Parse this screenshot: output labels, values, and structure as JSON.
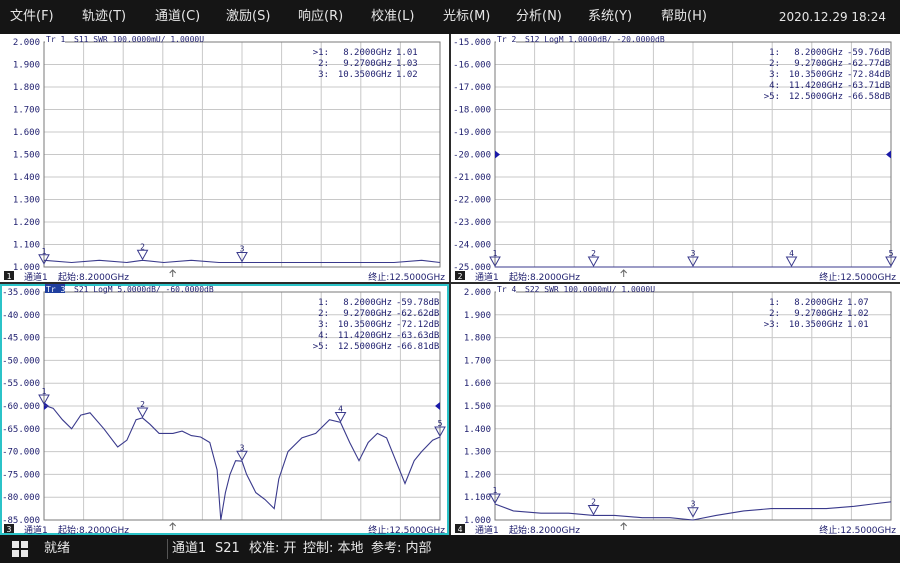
{
  "menu": [
    {
      "label": "文件(F)"
    },
    {
      "label": "轨迹(T)"
    },
    {
      "label": "通道(C)"
    },
    {
      "label": "激励(S)"
    },
    {
      "label": "响应(R)"
    },
    {
      "label": "校准(L)"
    },
    {
      "label": "光标(M)"
    },
    {
      "label": "分析(N)"
    },
    {
      "label": "系统(Y)"
    },
    {
      "label": "帮助(H)"
    }
  ],
  "datetime": "2020.12.29 18:24",
  "colors": {
    "grid": "#c8c8c8",
    "trace": "#3a3a8c",
    "text": "#1e1e6e",
    "active_border": "#2bc3c8",
    "footer_bg": "#ffffff"
  },
  "panels": [
    {
      "id": 1,
      "trace_label": "Tr 1",
      "trace_header": "S11 SWR 100.0000mU/ 1.0000U",
      "active": false,
      "y_ticks": [
        "2.000",
        "1.900",
        "1.800",
        "1.700",
        "1.600",
        "1.500",
        "1.400",
        "1.300",
        "1.200",
        "1.100",
        "1.000"
      ],
      "y_range": [
        1.0,
        2.0
      ],
      "ref_value": null,
      "trace": [
        [
          8.2,
          1.03
        ],
        [
          8.5,
          1.02
        ],
        [
          8.8,
          1.03
        ],
        [
          9.1,
          1.02
        ],
        [
          9.27,
          1.03
        ],
        [
          9.5,
          1.02
        ],
        [
          9.8,
          1.03
        ],
        [
          10.1,
          1.02
        ],
        [
          10.35,
          1.02
        ],
        [
          10.7,
          1.02
        ],
        [
          11.0,
          1.02
        ],
        [
          11.5,
          1.02
        ],
        [
          12.0,
          1.02
        ],
        [
          12.3,
          1.03
        ],
        [
          12.5,
          1.02
        ]
      ],
      "markers": [
        {
          "label": "1",
          "x": 8.2,
          "y": 1.01,
          "freq": "8.2000GHz",
          "value": "1.01",
          "selected": true
        },
        {
          "label": "2",
          "x": 9.27,
          "y": 1.03,
          "freq": "9.2700GHz",
          "value": "1.03",
          "selected": false
        },
        {
          "label": "3",
          "x": 10.35,
          "y": 1.02,
          "freq": "10.3500GHz",
          "value": "1.02",
          "selected": false
        }
      ],
      "footer": {
        "num": "1",
        "channel": "通道1",
        "start": "起始:8.2000GHz",
        "stop": "终止:12.5000GHz"
      }
    },
    {
      "id": 2,
      "trace_label": "Tr 2",
      "trace_header": "S12 LogM 1.0000dB/ -20.0000dB",
      "active": false,
      "y_ticks": [
        "-15.000",
        "-16.000",
        "-17.000",
        "-18.000",
        "-19.000",
        "-20.000",
        "-21.000",
        "-22.000",
        "-23.000",
        "-24.000",
        "-25.000"
      ],
      "y_range": [
        -25.0,
        -15.0
      ],
      "ref_value": -20.0,
      "trace": [
        [
          8.2,
          -25.0
        ],
        [
          12.5,
          -25.0
        ]
      ],
      "markers": [
        {
          "label": "1",
          "x": 8.2,
          "y": -25.0,
          "freq": "8.2000GHz",
          "value": "-59.76dB",
          "selected": false
        },
        {
          "label": "2",
          "x": 9.27,
          "y": -25.0,
          "freq": "9.2700GHz",
          "value": "-62.77dB",
          "selected": false
        },
        {
          "label": "3",
          "x": 10.35,
          "y": -25.0,
          "freq": "10.3500GHz",
          "value": "-72.84dB",
          "selected": false
        },
        {
          "label": "4",
          "x": 11.42,
          "y": -25.0,
          "freq": "11.4200GHz",
          "value": "-63.71dB",
          "selected": false
        },
        {
          "label": "5",
          "x": 12.5,
          "y": -25.0,
          "freq": "12.5000GHz",
          "value": "-66.58dB",
          "selected": true
        }
      ],
      "footer": {
        "num": "2",
        "channel": "通道1",
        "start": "起始:8.2000GHz",
        "stop": "终止:12.5000GHz"
      }
    },
    {
      "id": 3,
      "trace_label": "Tr 3",
      "trace_header": "S21 LogM 5.0000dB/ -60.0000dB",
      "active": true,
      "y_ticks": [
        "-35.000",
        "-40.000",
        "-45.000",
        "-50.000",
        "-55.000",
        "-60.000",
        "-65.000",
        "-70.000",
        "-75.000",
        "-80.000",
        "-85.000"
      ],
      "y_range": [
        -85.0,
        -35.0
      ],
      "ref_value": -60.0,
      "trace": [
        [
          8.2,
          -59.8
        ],
        [
          8.3,
          -60.5
        ],
        [
          8.4,
          -63.0
        ],
        [
          8.5,
          -65.0
        ],
        [
          8.6,
          -62.0
        ],
        [
          8.7,
          -61.5
        ],
        [
          8.85,
          -65.0
        ],
        [
          9.0,
          -69.0
        ],
        [
          9.1,
          -67.5
        ],
        [
          9.2,
          -63.0
        ],
        [
          9.27,
          -62.6
        ],
        [
          9.35,
          -64.0
        ],
        [
          9.45,
          -66.0
        ],
        [
          9.6,
          -66.0
        ],
        [
          9.7,
          -65.5
        ],
        [
          9.8,
          -66.5
        ],
        [
          9.9,
          -66.8
        ],
        [
          10.0,
          -68.0
        ],
        [
          10.08,
          -74.0
        ],
        [
          10.12,
          -85.0
        ],
        [
          10.17,
          -79.0
        ],
        [
          10.22,
          -75.0
        ],
        [
          10.28,
          -72.0
        ],
        [
          10.35,
          -72.1
        ],
        [
          10.4,
          -75.0
        ],
        [
          10.5,
          -79.0
        ],
        [
          10.6,
          -80.5
        ],
        [
          10.7,
          -82.5
        ],
        [
          10.75,
          -76.0
        ],
        [
          10.85,
          -70.0
        ],
        [
          11.0,
          -67.0
        ],
        [
          11.15,
          -66.0
        ],
        [
          11.3,
          -63.0
        ],
        [
          11.42,
          -63.6
        ],
        [
          11.52,
          -68.0
        ],
        [
          11.62,
          -72.0
        ],
        [
          11.72,
          -68.0
        ],
        [
          11.82,
          -66.0
        ],
        [
          11.92,
          -67.0
        ],
        [
          12.02,
          -72.0
        ],
        [
          12.12,
          -77.0
        ],
        [
          12.22,
          -72.0
        ],
        [
          12.3,
          -70.0
        ],
        [
          12.42,
          -67.5
        ],
        [
          12.5,
          -66.8
        ]
      ],
      "markers": [
        {
          "label": "1",
          "x": 8.2,
          "y": -59.78,
          "freq": "8.2000GHz",
          "value": "-59.78dB",
          "selected": false
        },
        {
          "label": "2",
          "x": 9.27,
          "y": -62.62,
          "freq": "9.2700GHz",
          "value": "-62.62dB",
          "selected": false
        },
        {
          "label": "3",
          "x": 10.35,
          "y": -72.12,
          "freq": "10.3500GHz",
          "value": "-72.12dB",
          "selected": false
        },
        {
          "label": "4",
          "x": 11.42,
          "y": -63.63,
          "freq": "11.4200GHz",
          "value": "-63.63dB",
          "selected": false
        },
        {
          "label": "5",
          "x": 12.5,
          "y": -66.81,
          "freq": "12.5000GHz",
          "value": "-66.81dB",
          "selected": true
        }
      ],
      "footer": {
        "num": "3",
        "channel": "通道1",
        "start": "起始:8.2000GHz",
        "stop": "终止:12.5000GHz"
      }
    },
    {
      "id": 4,
      "trace_label": "Tr 4",
      "trace_header": "S22 SWR 100.0000mU/ 1.0000U",
      "active": false,
      "y_ticks": [
        "2.000",
        "1.900",
        "1.800",
        "1.700",
        "1.600",
        "1.500",
        "1.400",
        "1.300",
        "1.200",
        "1.100",
        "1.000"
      ],
      "y_range": [
        1.0,
        2.0
      ],
      "ref_value": null,
      "trace": [
        [
          8.2,
          1.07
        ],
        [
          8.4,
          1.04
        ],
        [
          8.7,
          1.03
        ],
        [
          9.0,
          1.03
        ],
        [
          9.27,
          1.02
        ],
        [
          9.5,
          1.02
        ],
        [
          9.8,
          1.01
        ],
        [
          10.1,
          1.01
        ],
        [
          10.35,
          1.0
        ],
        [
          10.6,
          1.02
        ],
        [
          10.9,
          1.04
        ],
        [
          11.2,
          1.05
        ],
        [
          11.5,
          1.05
        ],
        [
          11.8,
          1.05
        ],
        [
          12.1,
          1.06
        ],
        [
          12.3,
          1.07
        ],
        [
          12.5,
          1.08
        ]
      ],
      "markers": [
        {
          "label": "1",
          "x": 8.2,
          "y": 1.07,
          "freq": "8.2000GHz",
          "value": "1.07",
          "selected": false
        },
        {
          "label": "2",
          "x": 9.27,
          "y": 1.02,
          "freq": "9.2700GHz",
          "value": "1.02",
          "selected": false
        },
        {
          "label": "3",
          "x": 10.35,
          "y": 1.01,
          "freq": "10.3500GHz",
          "value": "1.01",
          "selected": true
        }
      ],
      "footer": {
        "num": "4",
        "channel": "通道1",
        "start": "起始:8.2000GHz",
        "stop": "终止:12.5000GHz"
      }
    }
  ],
  "x_range": [
    8.2,
    12.5
  ],
  "statusbar": {
    "ready": "就绪",
    "channel": "通道1",
    "sparam": "S21",
    "calibration": "校准: 开",
    "control": "控制: 本地",
    "reference": "参考: 内部"
  }
}
